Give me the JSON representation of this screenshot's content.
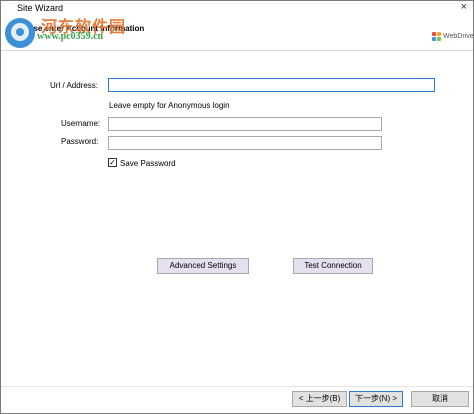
{
  "titlebar": {
    "title": "Site Wizard",
    "close": "×"
  },
  "watermark": {
    "site_name": "河东软件园",
    "url": "www.pc0359.cn"
  },
  "header": {
    "title": "Please enter Account Information",
    "logo_text": "WebDrive"
  },
  "form": {
    "url_label": "Url / Address:",
    "url_value": "",
    "url_hint": "Leave empty for Anonymous login",
    "username_label": "Username:",
    "username_value": "",
    "password_label": "Password:",
    "password_value": "",
    "save_password_label": "Save Password",
    "save_password_checked": "✓"
  },
  "buttons": {
    "advanced": "Advanced Settings",
    "test": "Test Connection",
    "back": "< 上一步(B)",
    "next": "下一步(N) >",
    "cancel": "取消"
  },
  "colors": {
    "accent": "#2a7ad6",
    "button_purple": "#e6dff0"
  },
  "icons": [
    "close-icon",
    "webdrive-logo-icon",
    "checkbox-checked-icon"
  ]
}
